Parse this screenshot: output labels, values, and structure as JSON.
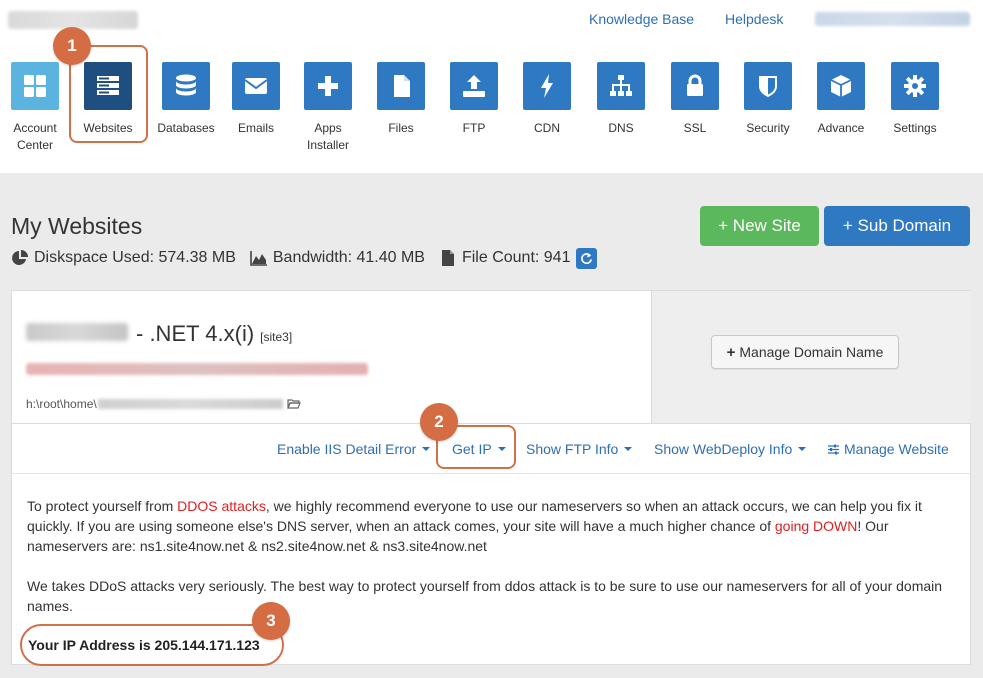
{
  "header": {
    "links": [
      {
        "label": "Knowledge Base"
      },
      {
        "label": "Helpdesk"
      }
    ]
  },
  "nav": {
    "items": [
      {
        "label": "Account Center",
        "icon": "grid-icon"
      },
      {
        "label": "Websites",
        "icon": "server-icon"
      },
      {
        "label": "Databases",
        "icon": "database-icon"
      },
      {
        "label": "Emails",
        "icon": "envelope-icon"
      },
      {
        "label": "Apps Installer",
        "icon": "plus-icon"
      },
      {
        "label": "Files",
        "icon": "file-icon"
      },
      {
        "label": "FTP",
        "icon": "upload-icon"
      },
      {
        "label": "CDN",
        "icon": "bolt-icon"
      },
      {
        "label": "DNS",
        "icon": "sitemap-icon"
      },
      {
        "label": "SSL",
        "icon": "lock-icon"
      },
      {
        "label": "Security",
        "icon": "shield-icon"
      },
      {
        "label": "Advance",
        "icon": "cube-icon"
      },
      {
        "label": "Settings",
        "icon": "gear-icon"
      }
    ],
    "active": "Websites"
  },
  "annotations": {
    "step1": "1",
    "step2": "2",
    "step3": "3",
    "highlight_color": "#d2704b"
  },
  "page": {
    "title": "My Websites",
    "stats": {
      "diskspace": "Diskspace Used: 574.38 MB",
      "bandwidth": "Bandwidth: 41.40 MB",
      "file_count": "File Count: 941"
    },
    "new_site_label": "+ New Site",
    "sub_domain_label": "+ Sub Domain"
  },
  "site": {
    "title": "- .NET 4.x(i)",
    "tag": "[site3]",
    "path_prefix": "h:\\root\\home\\",
    "manage_domain_label": "Manage Domain Name",
    "actions": {
      "iis": "Enable IIS Detail Error",
      "get_ip": "Get IP",
      "ftp": "Show FTP Info",
      "webdeploy": "Show WebDeploy Info",
      "manage": "Manage Website"
    }
  },
  "notice": {
    "p1_a": "To protect yourself from ",
    "p1_red1": "DDOS attacks",
    "p1_b": ", we highly recommend everyone to use our nameservers so when an attack occurs, we can help you fix it quickly. If you are using someone else's DNS server, when an attack comes, your site will have a much higher chance of ",
    "p1_red2": "going DOWN",
    "p1_c": "! Our nameservers are: ns1.site4now.net & ns2.site4now.net & ns3.site4now.net",
    "p2": "We takes DDoS attacks very seriously. The best way to protect yourself from ddos attack is to be sure to use our nameservers for all of your domain names.",
    "ip_line": "Your IP Address is 205.144.171.123"
  },
  "colors": {
    "primary": "#2f79c2",
    "success": "#5cb85c",
    "danger_text": "#e02020",
    "link": "#2d6fb5"
  }
}
